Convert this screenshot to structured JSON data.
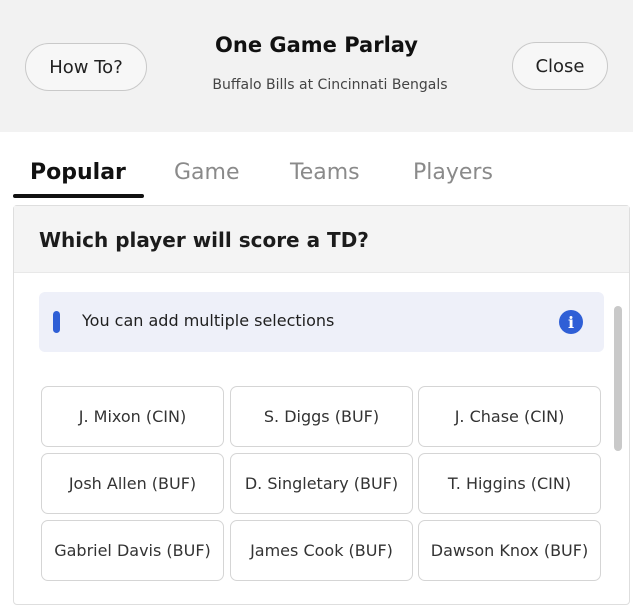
{
  "header": {
    "how_to_label": "How To?",
    "close_label": "Close",
    "title": "One Game Parlay",
    "subtitle": "Buffalo Bills at Cincinnati Bengals"
  },
  "tabs": [
    {
      "label": "Popular",
      "active": true
    },
    {
      "label": "Game",
      "active": false
    },
    {
      "label": "Teams",
      "active": false
    },
    {
      "label": "Players",
      "active": false
    }
  ],
  "market": {
    "question": "Which player will score a TD?",
    "info_text": "You can add multiple selections",
    "info_icon": "info-icon"
  },
  "selections": [
    [
      "J. Mixon (CIN)",
      "S. Diggs (BUF)",
      "J. Chase (CIN)"
    ],
    [
      "Josh Allen (BUF)",
      "D. Singletary (BUF)",
      "T. Higgins (CIN)"
    ],
    [
      "Gabriel Davis (BUF)",
      "James Cook (BUF)",
      "Dawson Knox (BUF)"
    ]
  ],
  "colors": {
    "accent": "#2f5fd6",
    "header_bg": "#f2f2f2"
  }
}
